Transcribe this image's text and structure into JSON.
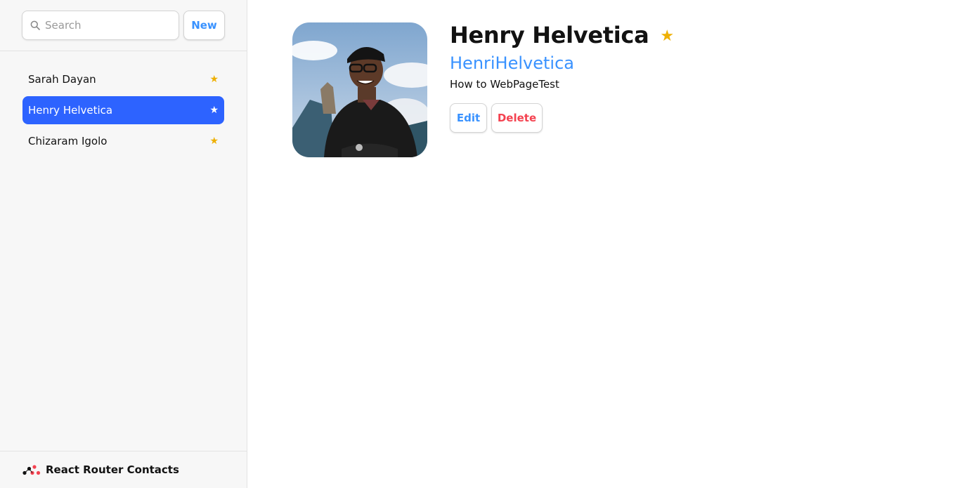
{
  "sidebar": {
    "search": {
      "placeholder": "Search",
      "value": ""
    },
    "new_label": "New",
    "contacts": [
      {
        "name": "Sarah Dayan",
        "favorite": true,
        "active": false
      },
      {
        "name": "Henry Helvetica",
        "favorite": true,
        "active": true
      },
      {
        "name": "Chizaram Igolo",
        "favorite": true,
        "active": false
      }
    ],
    "footer_title": "React Router Contacts"
  },
  "contact": {
    "name": "Henry Helvetica",
    "favorite_glyph": "★",
    "twitter": "HenriHelvetica",
    "notes": "How to WebPageTest",
    "edit_label": "Edit",
    "delete_label": "Delete",
    "avatar_icon": "person-photo"
  },
  "icons": {
    "search": "magnifier-icon",
    "star": "★",
    "logo": "react-router-logo"
  },
  "colors": {
    "accent": "#3992ff",
    "active": "#2d63ff",
    "star": "#eeb004",
    "danger": "#f44250"
  }
}
